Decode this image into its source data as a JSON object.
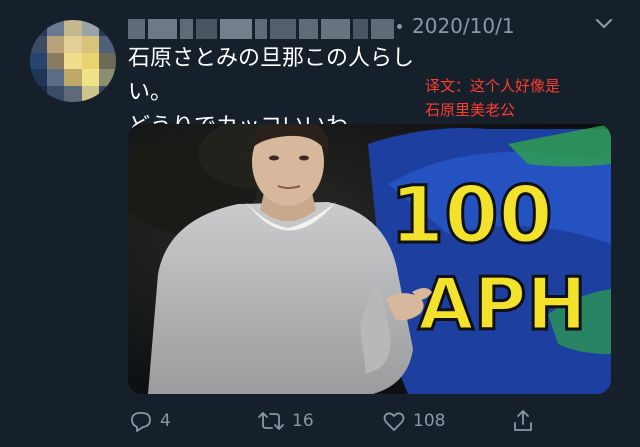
{
  "tweet": {
    "timestamp": "2020/10/1",
    "text": "石原さとみの旦那この人らしい。\nどうりでカッコいいわ。",
    "translation": "译文：这个人好像是\n石原里美老公",
    "media": {
      "sign_text": "100",
      "sign_text2": "APH"
    }
  },
  "actions": {
    "reply_count": "4",
    "retweet_count": "16",
    "like_count": "108"
  },
  "colors": {
    "background": "#15202b",
    "secondary_text": "#8899a6",
    "translation_red": "#ff3b30"
  },
  "icons": {
    "reply": "reply-icon",
    "retweet": "retweet-icon",
    "like": "heart-icon",
    "share": "share-icon",
    "more": "chevron-down-icon"
  }
}
